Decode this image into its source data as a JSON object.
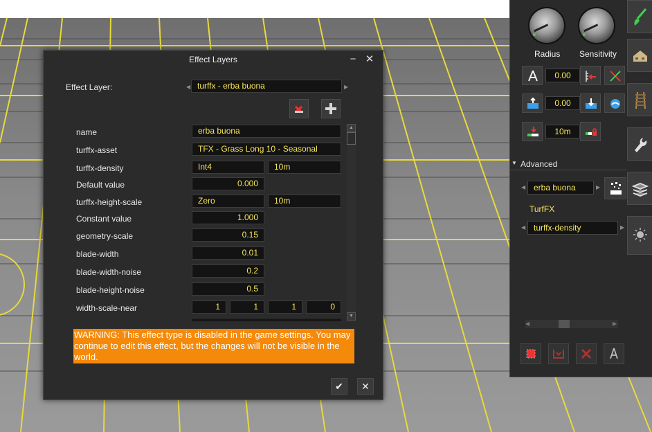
{
  "dialog": {
    "title": "Effect Layers",
    "minimize_icon": "minimize-icon",
    "close_icon": "close-icon",
    "effect_layer_label": "Effect Layer:",
    "effect_layer_value": "turffx - erba buona",
    "props": {
      "name": {
        "label": "name",
        "value": "erba buona"
      },
      "asset": {
        "label": "turffx-asset",
        "value": "TFX - Grass Long 10 - Seasonal"
      },
      "density": {
        "label": "turffx-density",
        "value": "Int4",
        "value2": "10m"
      },
      "default_value": {
        "label": "Default value",
        "value": "0.000"
      },
      "height_scale": {
        "label": "turffx-height-scale",
        "value": "Zero",
        "value2": "10m"
      },
      "constant_value": {
        "label": "Constant value",
        "value": "1.000"
      },
      "geometry_scale": {
        "label": "geometry-scale",
        "value": "0.15"
      },
      "blade_width": {
        "label": "blade-width",
        "value": "0.01"
      },
      "blade_width_noise": {
        "label": "blade-width-noise",
        "value": "0.2"
      },
      "blade_height_noise": {
        "label": "blade-height-noise",
        "value": "0.5"
      },
      "width_scale_near": {
        "label": "width-scale-near",
        "values": [
          "1",
          "1",
          "1",
          "0"
        ]
      }
    },
    "warning": "WARNING: This effect type is disabled in the game settings. You may continue to edit this effect, but the changes will not be visible in the world.",
    "ok_icon": "checkmark-icon",
    "cancel_icon": "close-icon"
  },
  "panel": {
    "radius_label": "Radius",
    "sensitivity_label": "Sensitivity",
    "row1_value": "0.00",
    "row2_value": "0.00",
    "row3_value": "10m",
    "advanced_label": "Advanced",
    "layer_value": "erba buona",
    "turffx_label": "TurfFX",
    "property_value": "turffx-density"
  },
  "colors": {
    "dialog_bg": "#2b2b2b",
    "field_text": "#f7e65c",
    "warning_bg": "#f58a0a",
    "grid_line": "#e8d93c"
  }
}
